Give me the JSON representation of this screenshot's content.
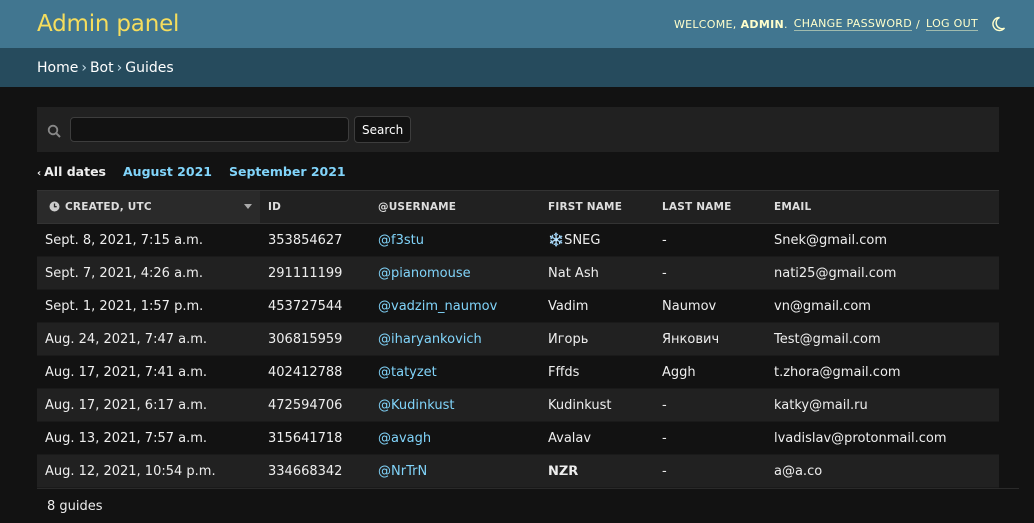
{
  "header": {
    "title": "Admin panel",
    "welcome": "Welcome,",
    "username": "admin",
    "change_password": "Change password",
    "separator": "/",
    "logout": "Log out",
    "theme_icon": "moon-icon"
  },
  "breadcrumbs": {
    "home": "Home",
    "app": "Bot",
    "current": "Guides",
    "sep": "›"
  },
  "search": {
    "value": "",
    "button": "Search",
    "icon": "search-icon"
  },
  "date_hierarchy": {
    "back_arrow": "‹",
    "all": "All dates",
    "months": [
      "August 2021",
      "September 2021"
    ]
  },
  "table": {
    "columns": [
      "Created, UTC",
      "ID",
      "@Username",
      "First name",
      "Last name",
      "Email"
    ],
    "rows": [
      {
        "created": "Sept. 8, 2021, 7:15 a.m.",
        "id": "353854627",
        "username": "@f3stu",
        "first_name": "❄️SNEG",
        "last_name": "-",
        "email": "Snek@gmail.com"
      },
      {
        "created": "Sept. 7, 2021, 4:26 a.m.",
        "id": "291111199",
        "username": "@pianomouse",
        "first_name": "Nat Ash",
        "last_name": "-",
        "email": "nati25@gmail.com"
      },
      {
        "created": "Sept. 1, 2021, 1:57 p.m.",
        "id": "453727544",
        "username": "@vadzim_naumov",
        "first_name": "Vadim",
        "last_name": "Naumov",
        "email": "vn@gmail.com"
      },
      {
        "created": "Aug. 24, 2021, 7:47 a.m.",
        "id": "306815959",
        "username": "@iharyankovich",
        "first_name": "Игорь",
        "last_name": "Янкович",
        "email": "Test@gmail.com"
      },
      {
        "created": "Aug. 17, 2021, 7:41 a.m.",
        "id": "402412788",
        "username": "@tatyzet",
        "first_name": "Fffds",
        "last_name": "Aggh",
        "email": "t.zhora@gmail.com"
      },
      {
        "created": "Aug. 17, 2021, 6:17 a.m.",
        "id": "472594706",
        "username": "@Kudinkust",
        "first_name": "Kudinkust",
        "last_name": "-",
        "email": "katky@mail.ru"
      },
      {
        "created": "Aug. 13, 2021, 7:57 a.m.",
        "id": "315641718",
        "username": "@avagh",
        "first_name": "Avalav",
        "last_name": "-",
        "email": "lvadislav@protonmail.com"
      },
      {
        "created": "Aug. 12, 2021, 10:54 p.m.",
        "id": "334668342",
        "username": "@NrTrN",
        "first_name": "𝗡𝗭𝗥",
        "last_name": "-",
        "email": "a@a.co"
      }
    ]
  },
  "paginator": {
    "count": "8 guides"
  },
  "colors": {
    "header_bg": "#417690",
    "breadcrumb_bg": "#264b5d",
    "brand": "#f5dd5d",
    "link": "#81d4fa",
    "page_bg": "#121212"
  }
}
